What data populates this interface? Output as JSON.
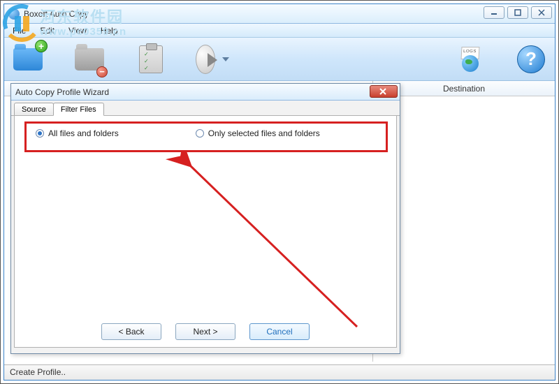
{
  "window": {
    "title": "Boxoft Auto Copy"
  },
  "menu": {
    "file": "File",
    "edit": "Edit",
    "view": "View",
    "help": "Help"
  },
  "columns": {
    "destination": "Destination"
  },
  "statusbar": {
    "text": "Create Profile.."
  },
  "dialog": {
    "title": "Auto Copy Profile Wizard",
    "tabs": {
      "source": "Source",
      "filter": "Filter Files"
    },
    "radios": {
      "all": "All files and folders",
      "selected": "Only selected files and folders",
      "checked": "all"
    },
    "buttons": {
      "back": "< Back",
      "next": "Next >",
      "cancel": "Cancel"
    }
  },
  "watermark": {
    "cn": "河东软件园",
    "url": "www.pc0359.cn"
  }
}
